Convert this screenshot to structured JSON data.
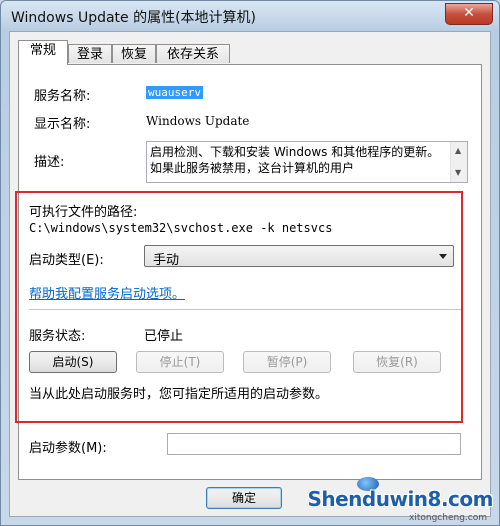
{
  "window": {
    "title": "Windows Update 的属性(本地计算机)",
    "close_label": "✕"
  },
  "tabs": [
    {
      "label": "常规",
      "active": true
    },
    {
      "label": "登录",
      "active": false
    },
    {
      "label": "恢复",
      "active": false
    },
    {
      "label": "依存关系",
      "active": false
    }
  ],
  "general": {
    "service_name_label": "服务名称:",
    "service_name_value": "wuauserv",
    "display_name_label": "显示名称:",
    "display_name_value": "Windows Update",
    "description_label": "描述:",
    "description_value": "启用检测、下载和安装 Windows 和其他程序的更新。如果此服务被禁用，这台计算机的用户",
    "exe_path_label": "可执行文件的路径:",
    "exe_path_value": "C:\\windows\\system32\\svchost.exe -k netsvcs",
    "startup_type_label": "启动类型(E):",
    "startup_type_value": "手动",
    "help_link": "帮助我配置服务启动选项。",
    "status_label": "服务状态:",
    "status_value": "已停止",
    "buttons": {
      "start": "启动(S)",
      "stop": "停止(T)",
      "pause": "暂停(P)",
      "resume": "恢复(R)"
    },
    "hint": "当从此处启动服务时，您可指定所适用的启动参数。",
    "start_params_label": "启动参数(M):",
    "start_params_value": ""
  },
  "footer": {
    "ok_label": "确定"
  },
  "watermark": {
    "brand": "Shenduwin8.com",
    "sub": "xitongcheng.com"
  },
  "colors": {
    "highlight_box": "#e0262f",
    "link": "#0066cc",
    "selection": "#3399ff"
  }
}
